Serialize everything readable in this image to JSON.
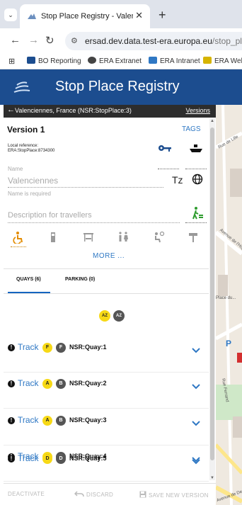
{
  "browser": {
    "tab_title": "Stop Place Registry - Valencien",
    "url_host": "ersad.dev.data.test-era.europa.eu",
    "url_path": "/stop_place/NS",
    "bookmarks": [
      "BO Reporting",
      "ERA Extranet",
      "ERA Intranet",
      "ERA Webs"
    ]
  },
  "app": {
    "title": "Stop Place Registry"
  },
  "panel": {
    "breadcrumb": "Valenciennes, France (NSR:StopPlace:3)",
    "versions_label": "Versions",
    "version_title": "Version 1",
    "tags_label": "TAGS",
    "local_ref_label": "Local reference:",
    "local_ref_value": "ERA:StopPlace:8734300",
    "name_label": "Name",
    "name_value": "Valenciennes",
    "name_required": "Name is required",
    "timezone_label": "Tz",
    "description_placeholder": "Description for travellers",
    "more_label": "MORE ...",
    "tabs": {
      "quays": "QUAYS (6)",
      "parking": "PARKING (0)"
    },
    "filters": [
      "AZ",
      "AZ"
    ],
    "quays": [
      {
        "track": "Track",
        "b1": "F",
        "b2": "F",
        "id": "NSR:Quay:1"
      },
      {
        "track": "Track",
        "b1": "A",
        "b2": "B",
        "id": "NSR:Quay:2"
      },
      {
        "track": "Track",
        "b1": "A",
        "b2": "B",
        "id": "NSR:Quay:3"
      },
      {
        "track": "Track",
        "b1": "E",
        "b2": "E",
        "id": "NSR:Quay:4"
      },
      {
        "track": "Track",
        "b1": "D",
        "b2": "D",
        "id": "NSR:Quay:5"
      }
    ],
    "footer": {
      "deactivate": "DEACTIVATE",
      "discard": "DISCARD",
      "save": "SAVE NEW VERSION"
    }
  },
  "map": {
    "letter_p": "P",
    "street_labels": [
      "Rue de Lille",
      "Avenue de l'Hôpital",
      "Place du...",
      "Rue Ferrand",
      "Avenue de Denain"
    ]
  },
  "colors": {
    "header": "#1c4d8f",
    "accent": "#2f78c4",
    "badge_yellow": "#f7d916",
    "badge_dark": "#555555",
    "facility_orange": "#e38c00"
  }
}
